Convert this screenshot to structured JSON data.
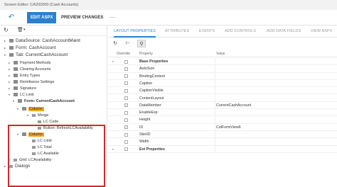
{
  "window": {
    "title": "Screen Editor: CA202000 (Cash Accounts)"
  },
  "toolbar": {
    "undo_glyph": "↶",
    "edit_label": "EDIT ASPX",
    "preview_label": "PREVIEW CHANGES",
    "more_glyph": "···"
  },
  "left_tools": {
    "refresh_glyph": "↻",
    "trash_glyph": "🗑",
    "caret_glyph": "▾"
  },
  "tree": [
    {
      "label": "DataSource: CashAccountMaint",
      "exp": "▸",
      "big": true
    },
    {
      "label": "Form: CashAccount",
      "exp": "▸",
      "big": true
    },
    {
      "label": "Tab: CurrentCashAccount",
      "exp": "▾",
      "big": true
    },
    {
      "label": "Payment Methods",
      "exp": "▸"
    },
    {
      "label": "Clearing Accounts",
      "exp": "▸"
    },
    {
      "label": "Entry Types",
      "exp": "▸"
    },
    {
      "label": "Remittance Settings",
      "exp": "▸"
    },
    {
      "label": "Signature",
      "exp": "▸"
    },
    {
      "label": "LC Limit",
      "exp": "▾"
    },
    {
      "label": "Form: CurrentCashAccount",
      "exp": "▾",
      "bold": true
    },
    {
      "label": "Column",
      "exp": "▾",
      "hl": true
    },
    {
      "label": "Merge",
      "exp": "▾"
    },
    {
      "label": "LC Code",
      "exp": ""
    },
    {
      "label": "Button: RefreshLCAvailability",
      "exp": ""
    },
    {
      "label": "Column",
      "exp": "▾",
      "hl": true
    },
    {
      "label": "LC Limit",
      "exp": ""
    },
    {
      "label": "LC Total",
      "exp": ""
    },
    {
      "label": "LC Available",
      "exp": ""
    },
    {
      "label": "Grid: LCAvailability",
      "exp": "▸"
    },
    {
      "label": "Dialogs",
      "exp": "▸",
      "big": true
    }
  ],
  "tabs": [
    "LAYOUT PROPERTIES",
    "ATTRIBUTES",
    "EVENTS",
    "ADD CONTROLS",
    "ADD DATA FIELDS",
    "VIEW ASPX"
  ],
  "prop_tools": {
    "refresh_glyph": "↻",
    "collapse_glyph": "⊢",
    "filter_glyph": "⚲"
  },
  "grid": {
    "headers": {
      "override": "Override",
      "property": "Property",
      "value": "Value"
    },
    "rows": [
      {
        "property": "Base Properties",
        "value": "",
        "group": true,
        "checked": false
      },
      {
        "property": "AutoSize",
        "value": "",
        "group": false,
        "checked": false
      },
      {
        "property": "BindingContext",
        "value": "",
        "group": false,
        "checked": false
      },
      {
        "property": "Caption",
        "value": "",
        "group": false,
        "checked": false
      },
      {
        "property": "CaptionVisible",
        "value": "",
        "group": false,
        "checked": false
      },
      {
        "property": "ContentLayout",
        "value": "",
        "group": false,
        "checked": false
      },
      {
        "property": "DataMember",
        "value": "CurrentCashAccount",
        "group": false,
        "checked": true
      },
      {
        "property": "EnableExp",
        "value": "",
        "group": false,
        "checked": false
      },
      {
        "property": "Height",
        "value": "",
        "group": false,
        "checked": false
      },
      {
        "property": "ID",
        "value": "CstFormView6",
        "group": false,
        "checked": true
      },
      {
        "property": "SkinID",
        "value": "",
        "group": false,
        "checked": false
      },
      {
        "property": "Width",
        "value": "",
        "group": false,
        "checked": false
      },
      {
        "property": "Ext Properties",
        "value": "",
        "group": true,
        "checked": false
      }
    ]
  },
  "colors": {
    "accent": "#2b80cf",
    "highlight": "#f5a623",
    "callout": "#d9262b"
  }
}
